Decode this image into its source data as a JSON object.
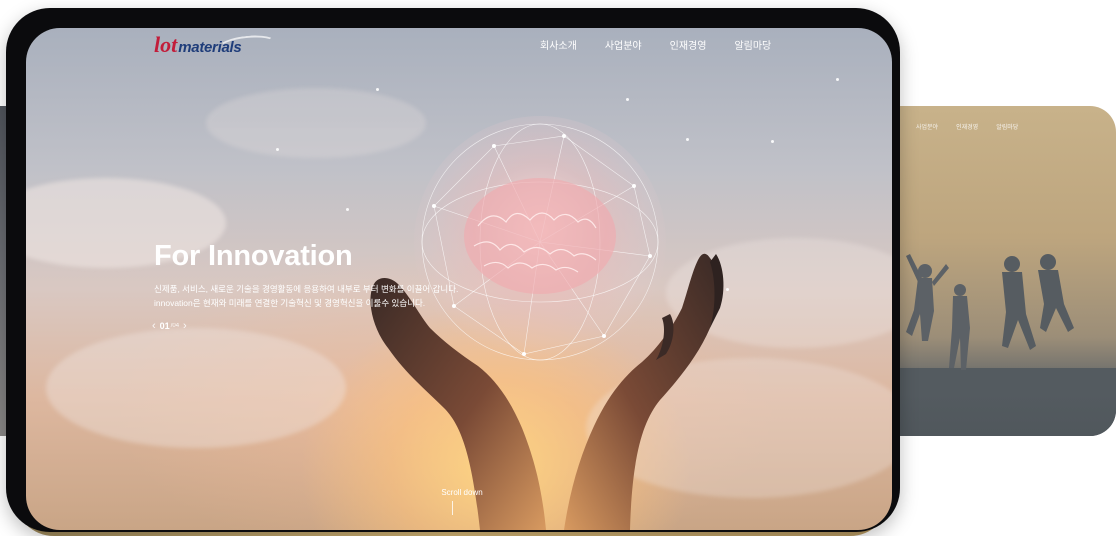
{
  "logo": {
    "mark": "lot",
    "text": "materials"
  },
  "nav": {
    "items": [
      "회사소개",
      "사업분야",
      "인재경영",
      "알림마당"
    ]
  },
  "hero": {
    "title": "For Innovation",
    "desc_line1": "신제품, 서비스, 새로운 기술을 경영활동에 응용하여 내부로 부터 변화를 이끌어 갑니다.",
    "desc_line2": "innovation은 현재와 미래를 연결한 기술혁신 및 경영혁신을 이룰수 있습니다.",
    "page_current": "01",
    "page_total": "/04",
    "prev_icon": "chevron-left-icon",
    "next_icon": "chevron-right-icon"
  },
  "scroll": {
    "label": "Scroll down"
  },
  "secondary_slide": {
    "nav": [
      "사업분야",
      "인재경영",
      "알림마당"
    ]
  },
  "colors": {
    "logo_red": "#c21d3a",
    "logo_blue": "#1f3d7a",
    "frame": "#0b0b0d",
    "accent_gold": "#d8b978"
  }
}
